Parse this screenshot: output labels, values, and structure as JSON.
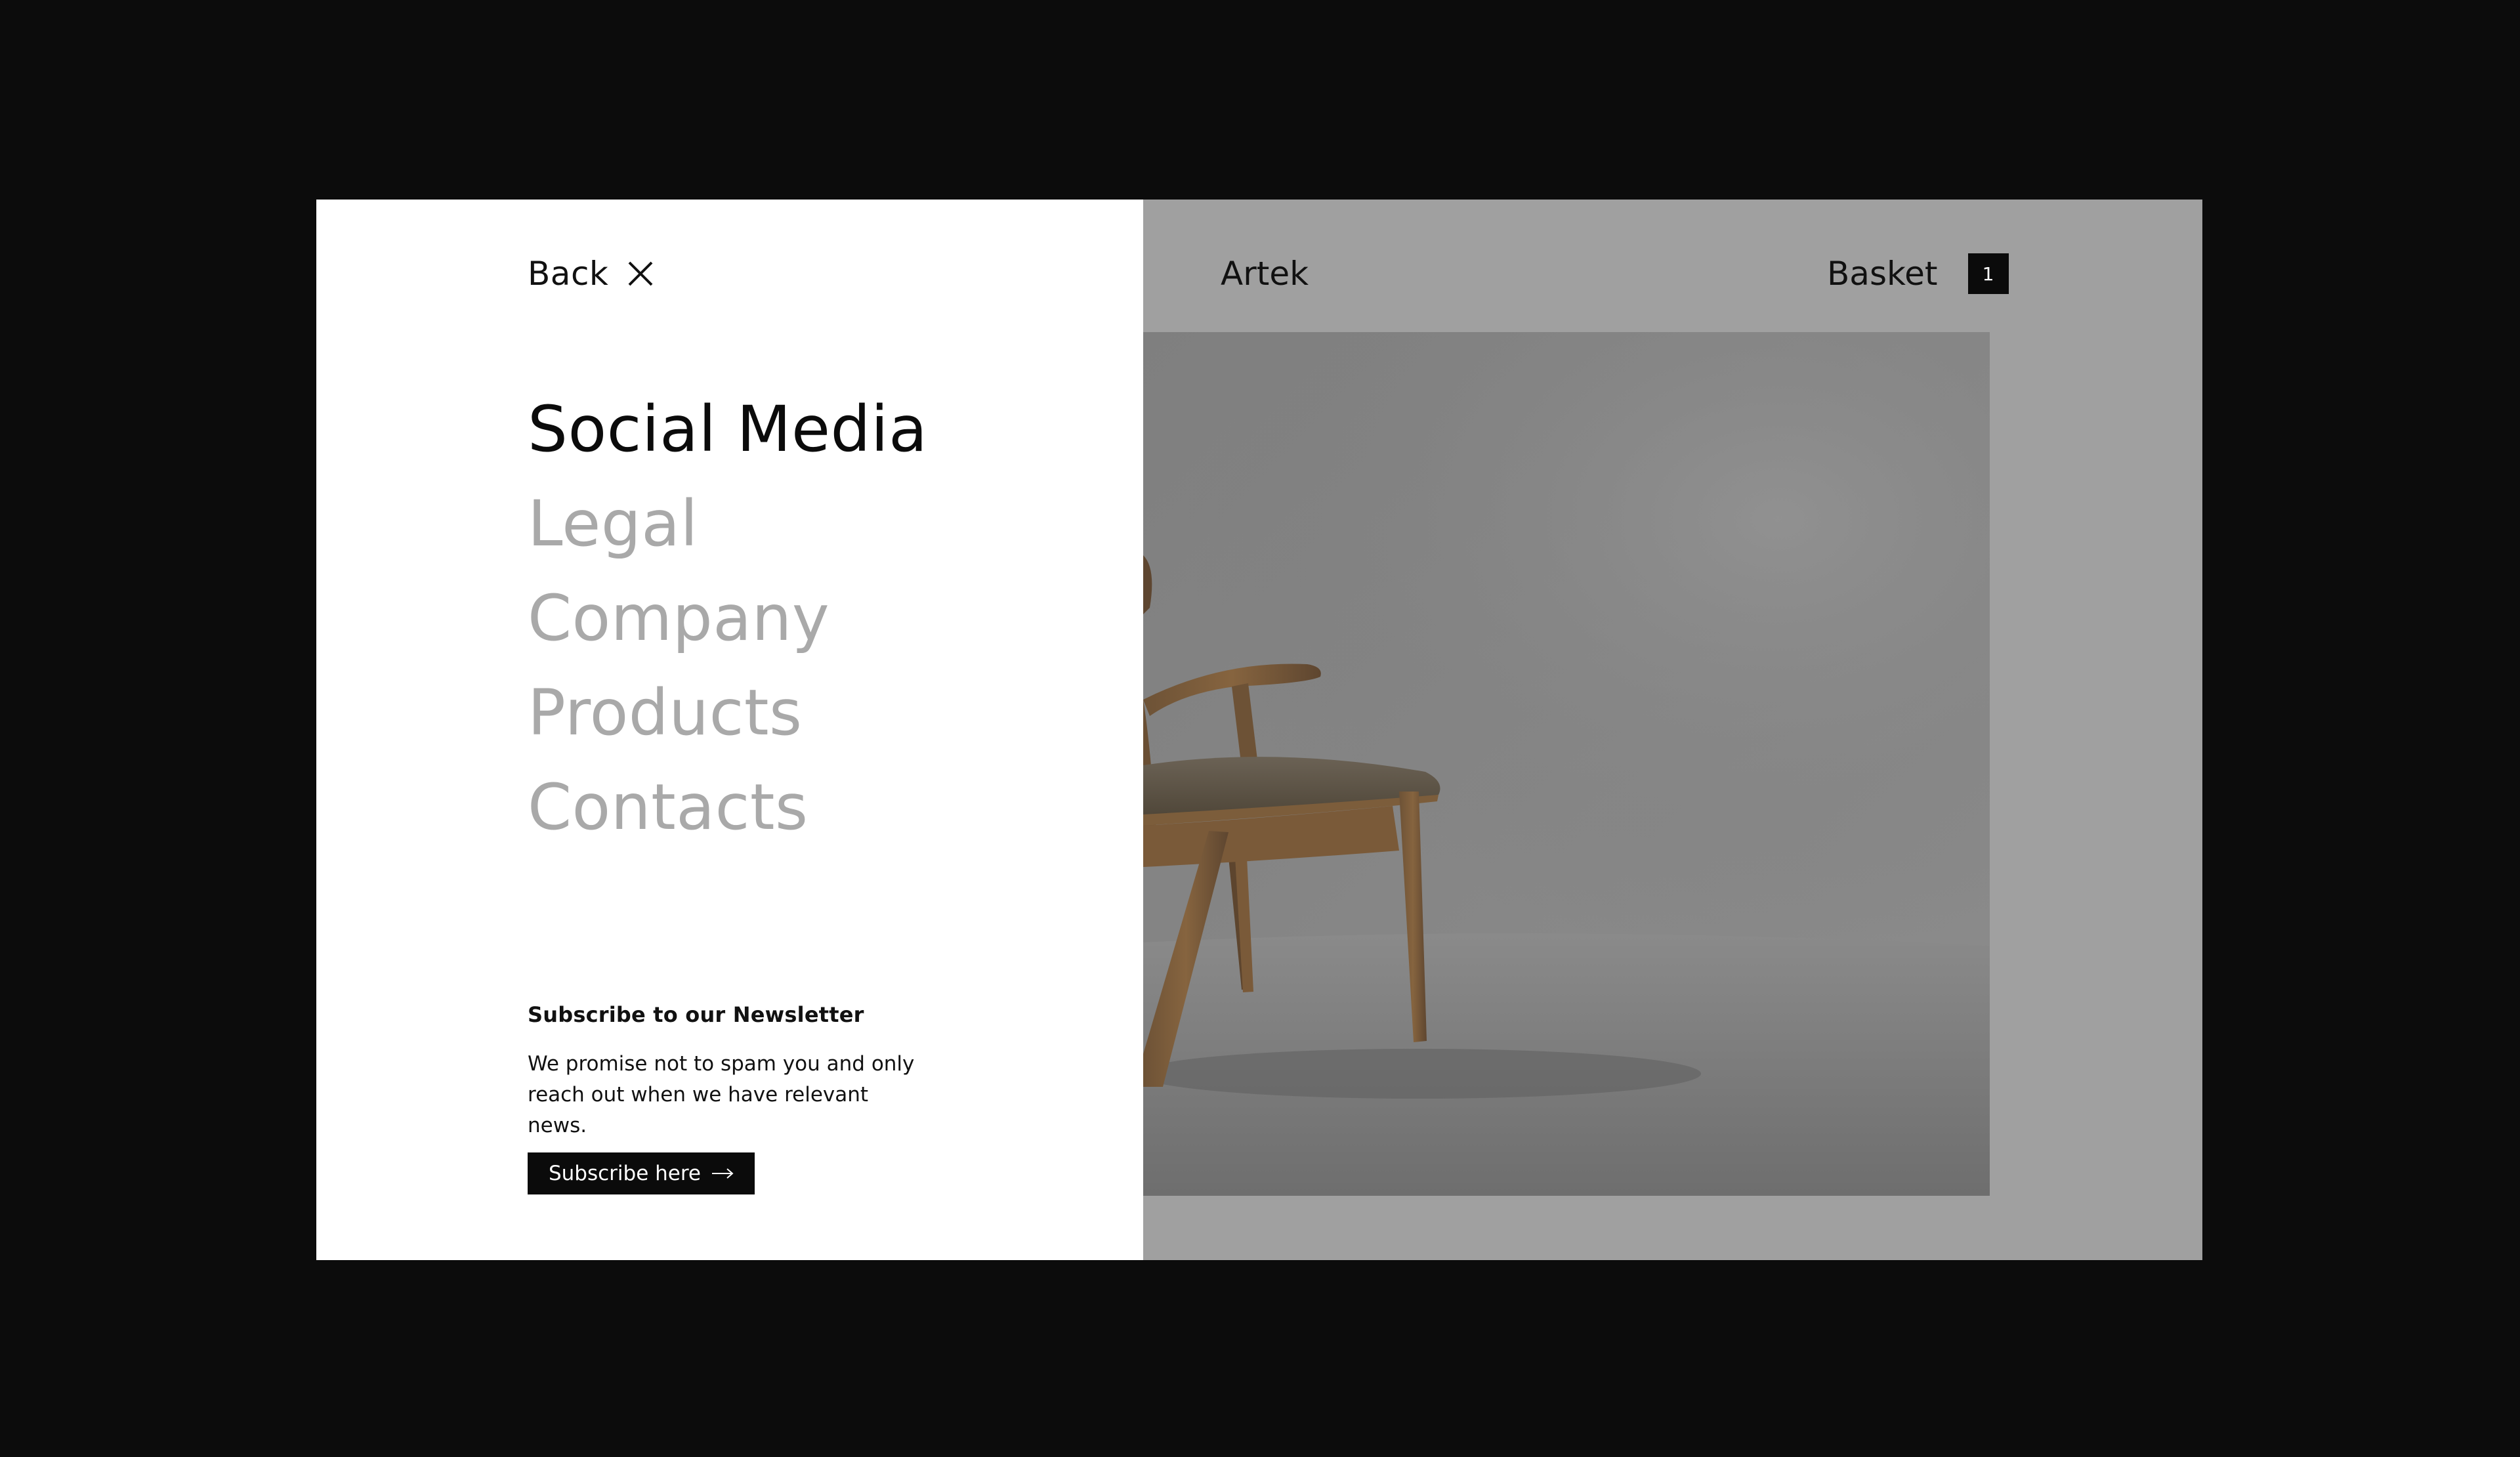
{
  "menu": {
    "back_label": "Back",
    "items": [
      {
        "label": "Social Media",
        "active": true
      },
      {
        "label": "Legal",
        "active": false
      },
      {
        "label": "Company",
        "active": false
      },
      {
        "label": "Products",
        "active": false
      },
      {
        "label": "Contacts",
        "active": false
      }
    ]
  },
  "newsletter": {
    "title": "Subscribe to our Newsletter",
    "text": "We promise not to spam you and only reach out when we have relevant news.",
    "button_label": "Subscribe here"
  },
  "header": {
    "brand": "Artek",
    "basket_label": "Basket",
    "basket_count": "1"
  },
  "icons": {
    "close": "close-icon",
    "arrow": "arrow-right-icon"
  },
  "colors": {
    "frame_background": "#0c0c0c",
    "menu_background": "#ffffff",
    "overlay_background": "#a0a0a0",
    "active_text": "#0b0b0b",
    "inactive_text": "#a9a9a9",
    "button_background": "#0b0b0b"
  }
}
